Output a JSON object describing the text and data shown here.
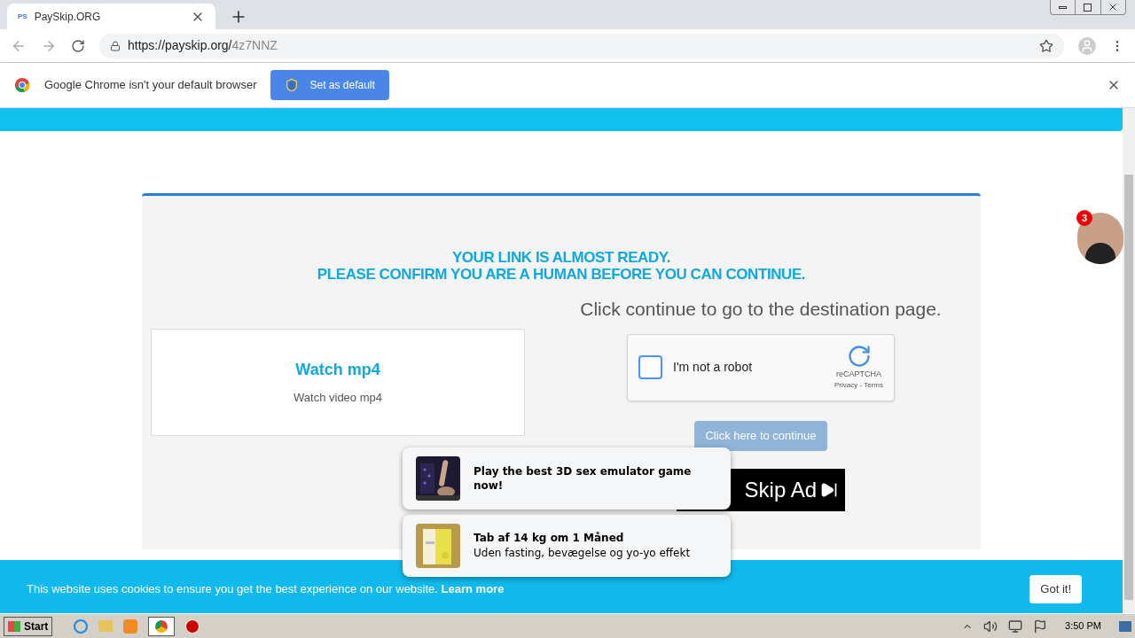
{
  "browser": {
    "tab": {
      "title": "PaySkip.ORG",
      "favicon": "PS"
    },
    "address": {
      "host": "https://payskip.org/",
      "path": "4z7NNZ"
    }
  },
  "infobar": {
    "message": "Google Chrome isn't your default browser",
    "button": "Set as default"
  },
  "page": {
    "heading": [
      "YOUR LINK IS ALMOST READY.",
      "PLEASE CONFIRM YOU ARE A HUMAN BEFORE YOU CAN CONTINUE."
    ],
    "instruction": "Click continue to go to the destination page.",
    "download_card": {
      "title": "Watch mp4",
      "subtitle": "Watch video mp4"
    },
    "captcha": {
      "label": "I'm not a robot",
      "checked": false,
      "brand": "reCAPTCHA",
      "links": "Privacy - Terms"
    },
    "continue_button": {
      "label": "Click here to continue",
      "disabled": true
    },
    "skip_ad": "Skip Ad"
  },
  "chat_badge": "3",
  "notifications": [
    {
      "title": "Play the best 3D sex emulator game now!",
      "kind": "picture"
    },
    {
      "title": "Tab af 14 kg om 1 Måned",
      "body": "Uden fasting, bevægelse og yo-yo effekt",
      "kind": "picture"
    }
  ],
  "cookie_bar": {
    "text": "This website uses cookies to ensure you get the best experience on our website.",
    "link": "Learn more",
    "button": "Got it!"
  },
  "taskbar": {
    "start": "Start",
    "clock": "3:50 PM"
  }
}
